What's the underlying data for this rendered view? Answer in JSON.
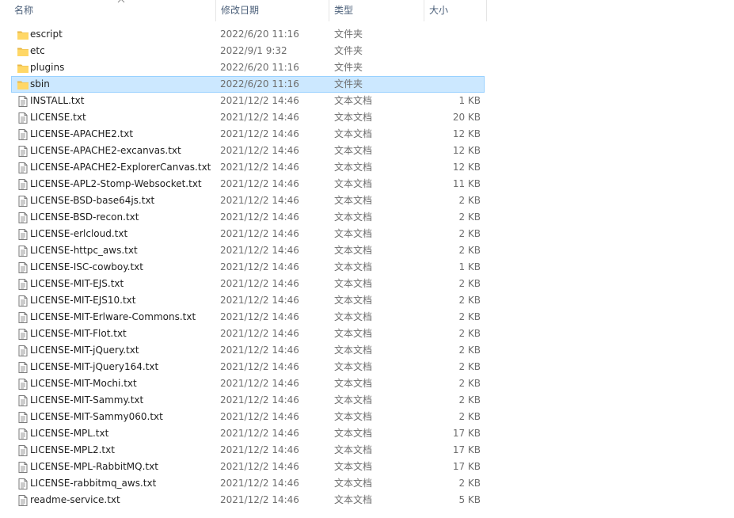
{
  "columns": {
    "name": "名称",
    "date": "修改日期",
    "type": "类型",
    "size": "大小"
  },
  "sort": {
    "column": "name",
    "direction": "ascending"
  },
  "items": [
    {
      "name": "escript",
      "date": "2022/6/20 11:16",
      "type": "文件夹",
      "size": "",
      "kind": "folder",
      "icon": "folder-icon"
    },
    {
      "name": "etc",
      "date": "2022/9/1 9:32",
      "type": "文件夹",
      "size": "",
      "kind": "folder",
      "icon": "folder-icon"
    },
    {
      "name": "plugins",
      "date": "2022/6/20 11:16",
      "type": "文件夹",
      "size": "",
      "kind": "folder",
      "icon": "folder-icon"
    },
    {
      "name": "sbin",
      "date": "2022/6/20 11:16",
      "type": "文件夹",
      "size": "",
      "kind": "folder",
      "icon": "folder-icon",
      "selected": true
    },
    {
      "name": "INSTALL.txt",
      "date": "2021/12/2 14:46",
      "type": "文本文档",
      "size": "1 KB",
      "kind": "file",
      "icon": "text-file-icon"
    },
    {
      "name": "LICENSE.txt",
      "date": "2021/12/2 14:46",
      "type": "文本文档",
      "size": "20 KB",
      "kind": "file",
      "icon": "text-file-icon"
    },
    {
      "name": "LICENSE-APACHE2.txt",
      "date": "2021/12/2 14:46",
      "type": "文本文档",
      "size": "12 KB",
      "kind": "file",
      "icon": "text-file-icon"
    },
    {
      "name": "LICENSE-APACHE2-excanvas.txt",
      "date": "2021/12/2 14:46",
      "type": "文本文档",
      "size": "12 KB",
      "kind": "file",
      "icon": "text-file-icon"
    },
    {
      "name": "LICENSE-APACHE2-ExplorerCanvas.txt",
      "date": "2021/12/2 14:46",
      "type": "文本文档",
      "size": "12 KB",
      "kind": "file",
      "icon": "text-file-icon"
    },
    {
      "name": "LICENSE-APL2-Stomp-Websocket.txt",
      "date": "2021/12/2 14:46",
      "type": "文本文档",
      "size": "11 KB",
      "kind": "file",
      "icon": "text-file-icon"
    },
    {
      "name": "LICENSE-BSD-base64js.txt",
      "date": "2021/12/2 14:46",
      "type": "文本文档",
      "size": "2 KB",
      "kind": "file",
      "icon": "text-file-icon"
    },
    {
      "name": "LICENSE-BSD-recon.txt",
      "date": "2021/12/2 14:46",
      "type": "文本文档",
      "size": "2 KB",
      "kind": "file",
      "icon": "text-file-icon"
    },
    {
      "name": "LICENSE-erlcloud.txt",
      "date": "2021/12/2 14:46",
      "type": "文本文档",
      "size": "2 KB",
      "kind": "file",
      "icon": "text-file-icon"
    },
    {
      "name": "LICENSE-httpc_aws.txt",
      "date": "2021/12/2 14:46",
      "type": "文本文档",
      "size": "2 KB",
      "kind": "file",
      "icon": "text-file-icon"
    },
    {
      "name": "LICENSE-ISC-cowboy.txt",
      "date": "2021/12/2 14:46",
      "type": "文本文档",
      "size": "1 KB",
      "kind": "file",
      "icon": "text-file-icon"
    },
    {
      "name": "LICENSE-MIT-EJS.txt",
      "date": "2021/12/2 14:46",
      "type": "文本文档",
      "size": "2 KB",
      "kind": "file",
      "icon": "text-file-icon"
    },
    {
      "name": "LICENSE-MIT-EJS10.txt",
      "date": "2021/12/2 14:46",
      "type": "文本文档",
      "size": "2 KB",
      "kind": "file",
      "icon": "text-file-icon"
    },
    {
      "name": "LICENSE-MIT-Erlware-Commons.txt",
      "date": "2021/12/2 14:46",
      "type": "文本文档",
      "size": "2 KB",
      "kind": "file",
      "icon": "text-file-icon"
    },
    {
      "name": "LICENSE-MIT-Flot.txt",
      "date": "2021/12/2 14:46",
      "type": "文本文档",
      "size": "2 KB",
      "kind": "file",
      "icon": "text-file-icon"
    },
    {
      "name": "LICENSE-MIT-jQuery.txt",
      "date": "2021/12/2 14:46",
      "type": "文本文档",
      "size": "2 KB",
      "kind": "file",
      "icon": "text-file-icon"
    },
    {
      "name": "LICENSE-MIT-jQuery164.txt",
      "date": "2021/12/2 14:46",
      "type": "文本文档",
      "size": "2 KB",
      "kind": "file",
      "icon": "text-file-icon"
    },
    {
      "name": "LICENSE-MIT-Mochi.txt",
      "date": "2021/12/2 14:46",
      "type": "文本文档",
      "size": "2 KB",
      "kind": "file",
      "icon": "text-file-icon"
    },
    {
      "name": "LICENSE-MIT-Sammy.txt",
      "date": "2021/12/2 14:46",
      "type": "文本文档",
      "size": "2 KB",
      "kind": "file",
      "icon": "text-file-icon"
    },
    {
      "name": "LICENSE-MIT-Sammy060.txt",
      "date": "2021/12/2 14:46",
      "type": "文本文档",
      "size": "2 KB",
      "kind": "file",
      "icon": "text-file-icon"
    },
    {
      "name": "LICENSE-MPL.txt",
      "date": "2021/12/2 14:46",
      "type": "文本文档",
      "size": "17 KB",
      "kind": "file",
      "icon": "text-file-icon"
    },
    {
      "name": "LICENSE-MPL2.txt",
      "date": "2021/12/2 14:46",
      "type": "文本文档",
      "size": "17 KB",
      "kind": "file",
      "icon": "text-file-icon"
    },
    {
      "name": "LICENSE-MPL-RabbitMQ.txt",
      "date": "2021/12/2 14:46",
      "type": "文本文档",
      "size": "17 KB",
      "kind": "file",
      "icon": "text-file-icon"
    },
    {
      "name": "LICENSE-rabbitmq_aws.txt",
      "date": "2021/12/2 14:46",
      "type": "文本文档",
      "size": "2 KB",
      "kind": "file",
      "icon": "text-file-icon"
    },
    {
      "name": "readme-service.txt",
      "date": "2021/12/2 14:46",
      "type": "文本文档",
      "size": "5 KB",
      "kind": "file",
      "icon": "text-file-icon"
    }
  ],
  "colors": {
    "header_text": "#4c607a",
    "selection_fill": "#cce8ff",
    "selection_border": "#99d1ff",
    "folder": "#ffd766",
    "secondary_text": "#6d6d6d"
  }
}
